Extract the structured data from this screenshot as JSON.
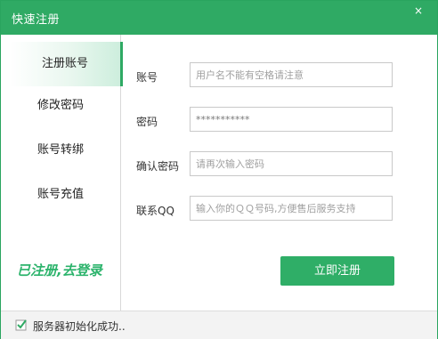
{
  "window": {
    "title": "快速注册",
    "close_glyph": "×"
  },
  "sidebar": {
    "items": [
      {
        "label": "注册账号",
        "active": true
      },
      {
        "label": "修改密码",
        "active": false
      },
      {
        "label": "账号转绑",
        "active": false
      },
      {
        "label": "账号充值",
        "active": false
      }
    ],
    "login_link": "已注册,去登录"
  },
  "form": {
    "fields": [
      {
        "label": "账号",
        "value": "用户名不能有空格请注意"
      },
      {
        "label": "密码",
        "value": "***********"
      },
      {
        "label": "确认密码",
        "value": "请再次输入密码"
      },
      {
        "label": "联系QQ",
        "value": "输入你的ＱＱ号码,方便售后服务支持"
      }
    ],
    "submit_label": "立即注册"
  },
  "status": {
    "text": "服务器初始化成功..",
    "icon": "check-icon"
  },
  "colors": {
    "accent": "#2faa64",
    "link": "#2bb36b"
  }
}
